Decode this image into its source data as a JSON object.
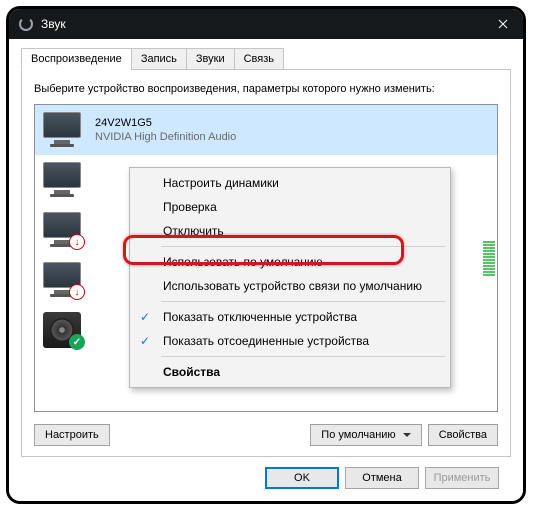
{
  "window": {
    "title": "Звук"
  },
  "tabs": [
    {
      "label": "Воспроизведение",
      "active": true
    },
    {
      "label": "Запись",
      "active": false
    },
    {
      "label": "Звуки",
      "active": false
    },
    {
      "label": "Связь",
      "active": false
    }
  ],
  "instruction": "Выберите устройство воспроизведения, параметры которого нужно изменить:",
  "devices": [
    {
      "title": "24V2W1G5",
      "subtitle": "NVIDIA High Definition Audio",
      "selected": true,
      "badge": "",
      "kind": "monitor"
    },
    {
      "title": "",
      "subtitle": "",
      "selected": false,
      "badge": "",
      "kind": "monitor"
    },
    {
      "title": "",
      "subtitle": "",
      "selected": false,
      "badge": "red",
      "kind": "monitor"
    },
    {
      "title": "",
      "subtitle": "",
      "selected": false,
      "badge": "red",
      "kind": "monitor"
    },
    {
      "title": "",
      "subtitle": "",
      "selected": false,
      "badge": "green",
      "kind": "speaker"
    }
  ],
  "panel_buttons": {
    "configure": "Настроить",
    "default": "По умолчанию",
    "properties": "Свойства"
  },
  "dialog_buttons": {
    "ok": "OK",
    "cancel": "Отмена",
    "apply": "Применить"
  },
  "context_menu": [
    {
      "label": "Настроить динамики",
      "type": "item"
    },
    {
      "label": "Проверка",
      "type": "item"
    },
    {
      "label": "Отключить",
      "type": "item"
    },
    {
      "type": "sep"
    },
    {
      "label": "Использовать по умолчанию",
      "type": "item",
      "highlighted": true
    },
    {
      "label": "Использовать устройство связи по умолчанию",
      "type": "item"
    },
    {
      "type": "sep"
    },
    {
      "label": "Показать отключенные устройства",
      "type": "item",
      "checked": true
    },
    {
      "label": "Показать отсоединенные устройства",
      "type": "item",
      "checked": true
    },
    {
      "type": "sep"
    },
    {
      "label": "Свойства",
      "type": "item",
      "bold": true
    }
  ]
}
